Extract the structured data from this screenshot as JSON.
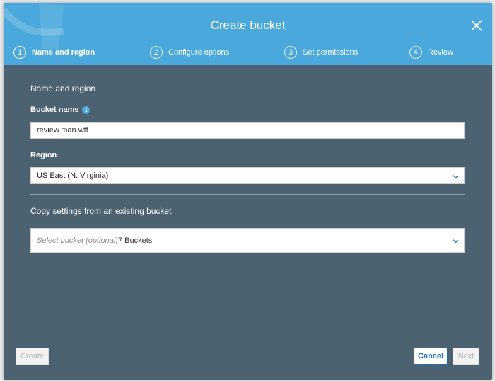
{
  "modal": {
    "title": "Create bucket"
  },
  "steps": [
    {
      "number": "1",
      "label": "Name and region",
      "active": true
    },
    {
      "number": "2",
      "label": "Configure options",
      "active": false
    },
    {
      "number": "3",
      "label": "Set permissions",
      "active": false
    },
    {
      "number": "4",
      "label": "Review",
      "active": false
    }
  ],
  "form": {
    "section_title": "Name and region",
    "bucket_name_label": "Bucket name",
    "bucket_name_value": "review.man.wtf",
    "region_label": "Region",
    "region_value": "US East (N. Virginia)",
    "copy_settings_title": "Copy settings from an existing bucket",
    "select_bucket_placeholder": "Select bucket (optional)",
    "select_bucket_count": "7 Buckets"
  },
  "footer": {
    "create_label": "Create",
    "cancel_label": "Cancel",
    "next_label": "Next"
  },
  "colors": {
    "header": "#4aa8dc",
    "body": "#4d6270",
    "accent": "#1b6fb5"
  },
  "icons": {
    "close": "close-icon",
    "info": "info-icon",
    "chevron": "chevron-down-icon"
  }
}
